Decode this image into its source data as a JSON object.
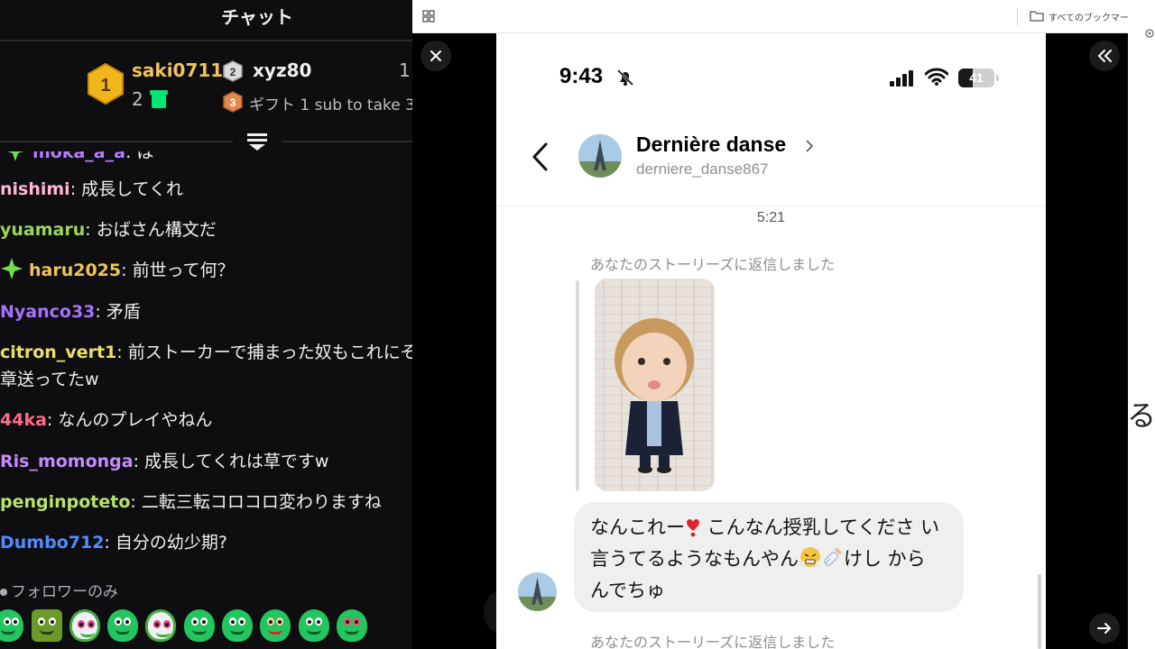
{
  "chat": {
    "title": "チャット",
    "leaderboard": {
      "first": {
        "rank": "1",
        "name": "saki0711",
        "count": "2"
      },
      "second": {
        "rank": "2",
        "name": "xyz80",
        "count": "1"
      },
      "third": {
        "rank": "3",
        "text": "ギフト 1 sub to take 3"
      }
    },
    "messages": [
      {
        "user": "moka_a_a",
        "text": ": は",
        "color": "#b57bff"
      },
      {
        "user": "nishimi",
        "text": ": 成長してくれ",
        "color": "#ffb7d5"
      },
      {
        "user": "yuamaru",
        "text": ": おばさん構文だ",
        "color": "#9bd65a"
      },
      {
        "user": "haru2025",
        "text": ": 前世って何？",
        "color": "#f0c35c"
      },
      {
        "user": "Nyanco33",
        "text": ": 矛盾",
        "color": "#a970ff"
      },
      {
        "user": "citron_vert1",
        "text": ": 前ストーカーで捕まった奴もこれにそ",
        "text2": "章送ってたw",
        "color": "#e9e06a"
      },
      {
        "user": "44ka",
        "text": ": なんのプレイやねん",
        "color": "#ff6b8a"
      },
      {
        "user": "Ris_momonga",
        "text": ": 成長してくれは草ですw",
        "color": "#c48bff"
      },
      {
        "user": "penginpoteto",
        "text": ": 二転三転コロコロ変わりますね",
        "color": "#b6e36a"
      },
      {
        "user": "Dumbo712",
        "text": ": 自分の幼少期?",
        "color": "#4f8cff"
      }
    ],
    "followers_only": "フォロワーのみ"
  },
  "browser": {
    "bookmarks_label": "すべてのブックマーク",
    "cut_off_char": "る"
  },
  "phone": {
    "status_time": "9:43",
    "battery_level": "41",
    "battery_fraction": 0.41,
    "contact_name": "Dernière danse",
    "contact_handle": "derniere_danse867",
    "timestamp": "5:21",
    "story_reply_label": "あなたのストーリーズに返信しました",
    "message_part1": "なんこれー",
    "message_part2": " こんなん授乳してくださ い言うてるようなもんやん",
    "message_part3": "けし からんでちゅ"
  },
  "colors": {
    "chat_bg": "#0e0e10",
    "gold": "#f0c35c",
    "phone_bg": "#ffffff",
    "bubble_bg": "#efefef"
  }
}
